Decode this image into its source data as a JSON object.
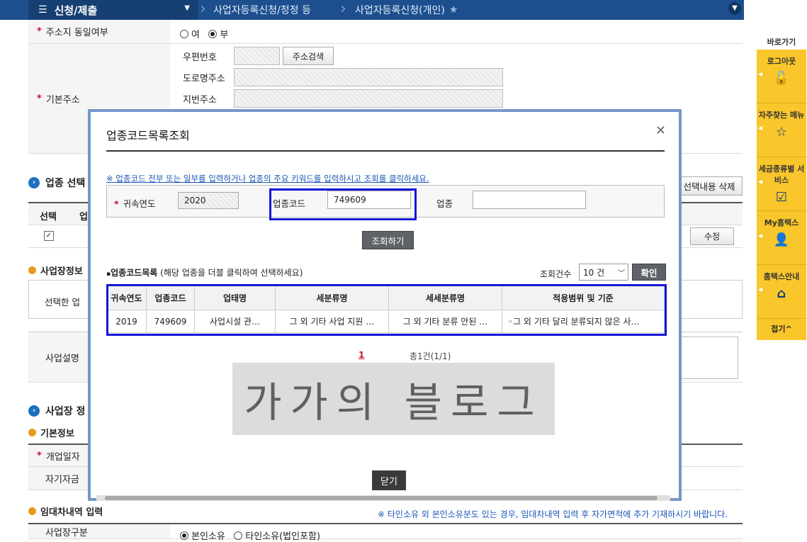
{
  "topnav": {
    "menu_label": "신청/제출",
    "crumb1": "사업자등록신청/정정 등",
    "crumb2": "사업자등록신청(개인)"
  },
  "form": {
    "same_address_label": "주소지 동일여부",
    "radio_yes": "여",
    "radio_no": "부",
    "base_address_label": "기본주소",
    "postal_label": "우편번호",
    "address_search_button": "주소검색",
    "road_address_label": "도로명주소",
    "lot_address_label": "지번주소",
    "industry_section": "업종 선택",
    "delete_selected_button": "선택내용 삭제",
    "col_select": "선택",
    "col_industry": "업",
    "edit_button": "수정",
    "workplace_info": "사업장정보",
    "selected_prefix": "선택한 업",
    "business_desc_label": "사업설명",
    "workplace_section": "사업장 정",
    "basic_info": "기본정보",
    "open_date_label": "개업일자",
    "own_capital_label": "자기자금",
    "lease_section": "임대차내역 입력",
    "lease_note": "※ 타인소유 외 본인소유분도 있는 경우, 임대차내역 입력 후 자가면적에 추가 기재하시기 바랍니다.",
    "workplace_type_label": "사업장구분",
    "own_property": "본인소유",
    "other_property": "타인소유(법인포함)"
  },
  "quick": {
    "title": "바로가기",
    "items": [
      "로그아웃",
      "자주찾는 메뉴",
      "세금종류별 서비스",
      "My홈택스",
      "홈택스안내"
    ],
    "fold": "접기^"
  },
  "modal": {
    "title": "업종코드목록조회",
    "note": "※ 업종코드 전부 또는 일부를 입력하거나 업종의 주요 키워드를 입력하시고 조회를 클릭하세요.",
    "year_label": "귀속연도",
    "year_value": "2020",
    "code_label": "업종코드",
    "code_value": "749609",
    "industry_label": "업종",
    "industry_value": "",
    "search_button": "조회하기",
    "list_title": "업종코드목록",
    "list_hint": " (해당 업종을 더블 클릭하여 선택하세요)",
    "count_label": "조회건수",
    "count_value": "10 건",
    "confirm_button": "확인",
    "columns": [
      "귀속연도",
      "업종코드",
      "업태명",
      "세분류명",
      "세세분류명",
      "적용범위 및 기준"
    ],
    "rows": [
      [
        "2019",
        "749609",
        "사업시설 관…",
        "그 외 기타 사업 지원 …",
        "그 외 기타 분류 안된 …",
        "◦그 외 기타 달리 분류되지 않은 사…"
      ]
    ],
    "page_current": "1",
    "page_total": "총1건(1/1)",
    "watermark": "가가의 블로그",
    "close_button": "닫기"
  }
}
